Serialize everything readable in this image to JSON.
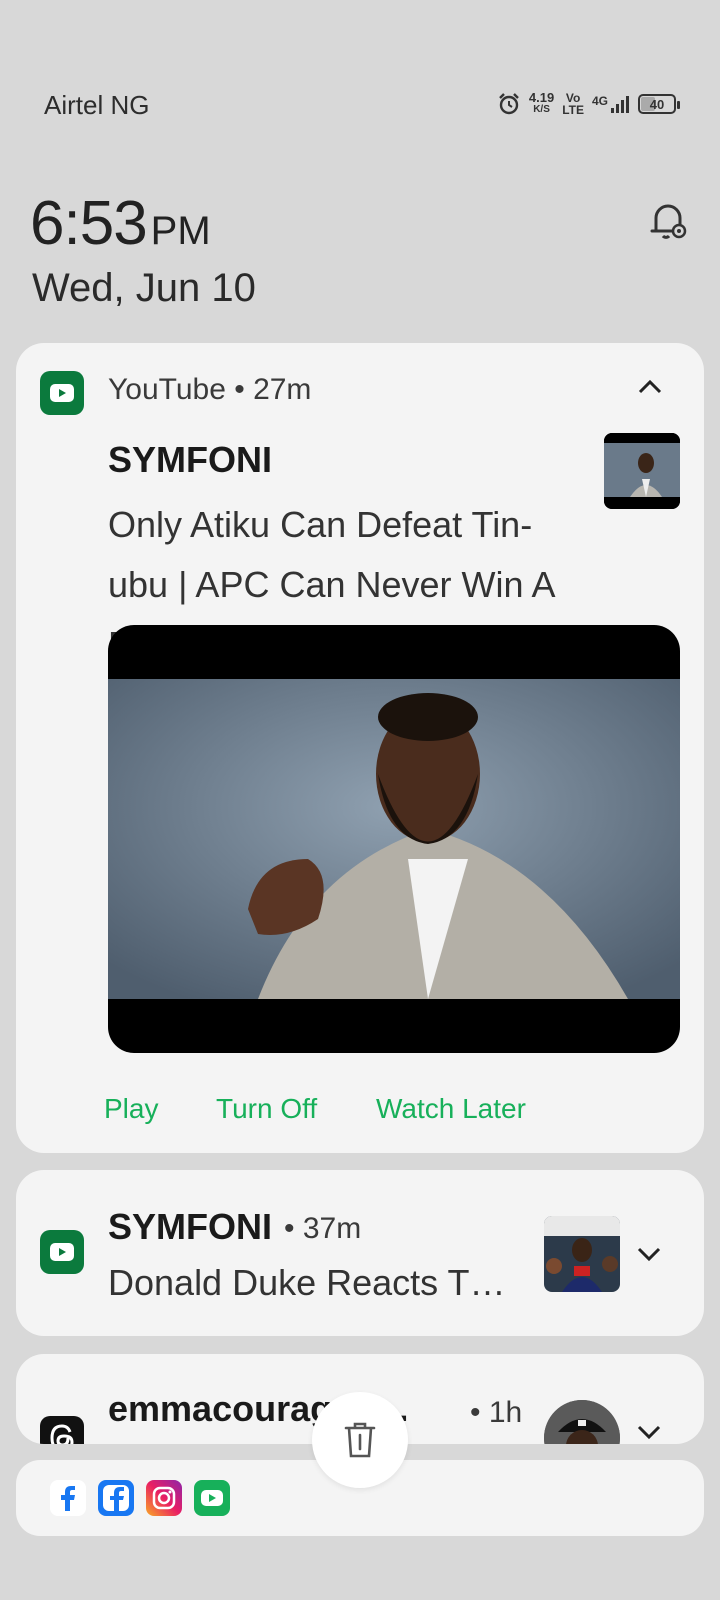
{
  "status_bar": {
    "carrier": "Airtel NG",
    "net_speed_value": "4.19",
    "net_speed_unit": "K/S",
    "volte_top": "Vo",
    "volte_bottom": "LTE",
    "network": "4G",
    "battery": "40",
    "battery_level": 0.4
  },
  "clock": {
    "time": "6:53",
    "ampm": "PM",
    "date": "Wed, Jun 10"
  },
  "notifications": [
    {
      "app": "YouTube",
      "age": "YouTube • 27m",
      "title": "SYMFONI",
      "body": "Only Atiku Can Defeat Tin-ubu | APC Can Never Win A Fre…",
      "actions": [
        "Play",
        "Turn Off",
        "Watch Later"
      ]
    },
    {
      "title": "SYMFONI",
      "age": "• 37m",
      "body": "Donald Duke Reacts T…"
    },
    {
      "title": "emmacourageo…",
      "age": "• 1h"
    }
  ],
  "colors": {
    "background": "#d8d8d8",
    "card": "#f4f4f4",
    "accent_green": "#17b05a",
    "youtube_icon_bg": "#0b7a3d"
  },
  "icons": [
    "alarm-icon",
    "signal-icon",
    "notification-settings-icon",
    "youtube-icon",
    "chevron-up-icon",
    "chevron-down-icon",
    "threads-icon",
    "trash-icon",
    "facebook-lite-icon",
    "facebook-icon",
    "instagram-icon",
    "youtube-dock-icon"
  ]
}
